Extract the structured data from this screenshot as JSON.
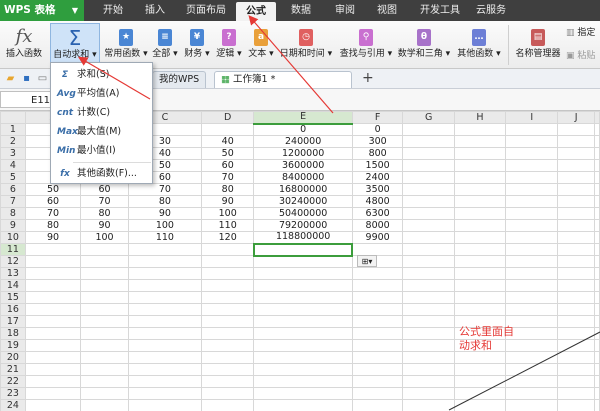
{
  "app": {
    "title": "WPS 表格"
  },
  "menu_tabs": [
    "开始",
    "插入",
    "页面布局",
    "公式",
    "数据",
    "审阅",
    "视图",
    "开发工具",
    "云服务"
  ],
  "ribbon": {
    "insert_function": "插入函数",
    "autosum": "自动求和",
    "common": "常用函数",
    "all": "全部",
    "finance": "财务",
    "logic": "逻辑",
    "text": "文本",
    "datetime": "日期和时间",
    "lookup": "查找与引用",
    "math": "数学和三角",
    "other": "其他函数",
    "name_manager": "名称管理器",
    "specify": "指定",
    "paste": "粘贴"
  },
  "doc_tabs": {
    "wps": "我的WPS",
    "workbook": "工作簿1 *"
  },
  "namebox": "E11",
  "columns": [
    "A",
    "B",
    "C",
    "D",
    "E",
    "F",
    "G",
    "H",
    "I",
    "J"
  ],
  "rows": [
    [
      "",
      "",
      "",
      "",
      "0",
      "0"
    ],
    [
      "1",
      "",
      "30",
      "40",
      "240000",
      "300"
    ],
    [
      "2",
      "",
      "40",
      "50",
      "1200000",
      "800"
    ],
    [
      "3",
      "",
      "50",
      "60",
      "3600000",
      "1500"
    ],
    [
      "4",
      "",
      "60",
      "70",
      "8400000",
      "2400"
    ],
    [
      "50",
      "60",
      "70",
      "80",
      "16800000",
      "3500"
    ],
    [
      "60",
      "70",
      "80",
      "90",
      "30240000",
      "4800"
    ],
    [
      "70",
      "80",
      "90",
      "100",
      "50400000",
      "6300"
    ],
    [
      "80",
      "90",
      "100",
      "110",
      "79200000",
      "8000"
    ],
    [
      "90",
      "100",
      "110",
      "120",
      "118800000",
      "9900"
    ]
  ],
  "row_count": 24,
  "dropdown": {
    "items": [
      {
        "icon": "Σ",
        "label": "求和(S)"
      },
      {
        "icon": "Avg",
        "label": "平均值(A)"
      },
      {
        "icon": "cnt",
        "label": "计数(C)"
      },
      {
        "icon": "Max",
        "label": "最大值(M)"
      },
      {
        "icon": "Min",
        "label": "最小值(I)"
      },
      {
        "icon": "fx",
        "label": "其他函数(F)..."
      }
    ]
  },
  "note": "公式里面自\n动求和",
  "colors": {
    "green": "#2f9e3e",
    "active": "#3c9d3c",
    "red_note": "#e53935"
  }
}
